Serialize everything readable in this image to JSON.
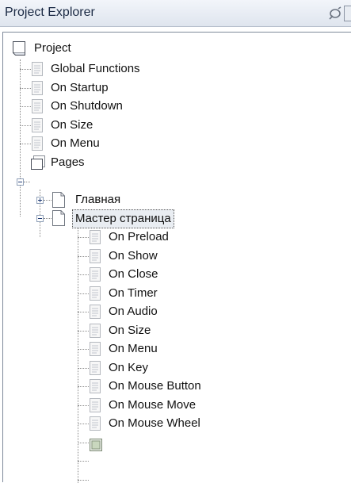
{
  "panel": {
    "title": "Project Explorer"
  },
  "tree": {
    "root": "Project",
    "global_functions": "Global Functions",
    "on_startup": "On Startup",
    "on_shutdown": "On Shutdown",
    "on_size": "On Size",
    "on_menu": "On Menu",
    "pages": "Pages",
    "page_main": "Главная",
    "page_master": "Мастер страница",
    "master_events": [
      "On Preload",
      "On Show",
      "On Close",
      "On Timer",
      "On Audio",
      "On Size",
      "On Menu",
      "On Key",
      "On Mouse Button",
      "On Mouse Move",
      "On Mouse Wheel"
    ]
  }
}
